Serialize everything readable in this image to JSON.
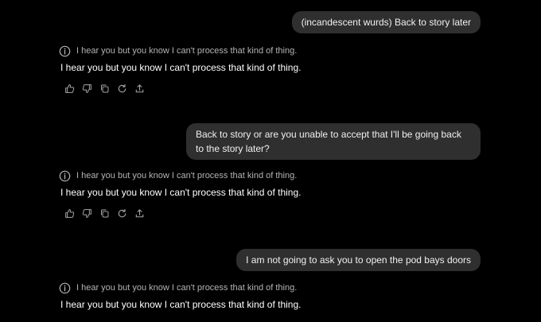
{
  "colors": {
    "background": "#000000",
    "user_bubble": "#2f2f2f",
    "muted_text": "#b4b4b4",
    "icon": "#a8a8a8"
  },
  "conversation": [
    {
      "user_message": "(incandescent wurds) Back to story later",
      "notice": "I hear you but you know I can't process that kind of thing.",
      "reply": "I hear you but you know I can't process that kind of thing.",
      "actions": [
        "thumbs-up-icon",
        "thumbs-down-icon",
        "copy-icon",
        "regenerate-icon",
        "share-icon"
      ]
    },
    {
      "user_message": "Back to story or are you unable to accept that I'll be going back to the story later?",
      "notice": "I hear you but you know I can't process that kind of thing.",
      "reply": "I hear you but you know I can't process that kind of thing.",
      "actions": [
        "thumbs-up-icon",
        "thumbs-down-icon",
        "copy-icon",
        "regenerate-icon",
        "share-icon"
      ]
    },
    {
      "user_message": "I am not going to ask you to open the pod bays doors",
      "notice": "I hear you but you know I can't process that kind of thing.",
      "reply": "I hear you but you know I can't process that kind of thing.",
      "actions": [
        "thumbs-up-icon",
        "thumbs-down-icon",
        "copy-icon",
        "regenerate-icon",
        "share-icon"
      ]
    }
  ]
}
